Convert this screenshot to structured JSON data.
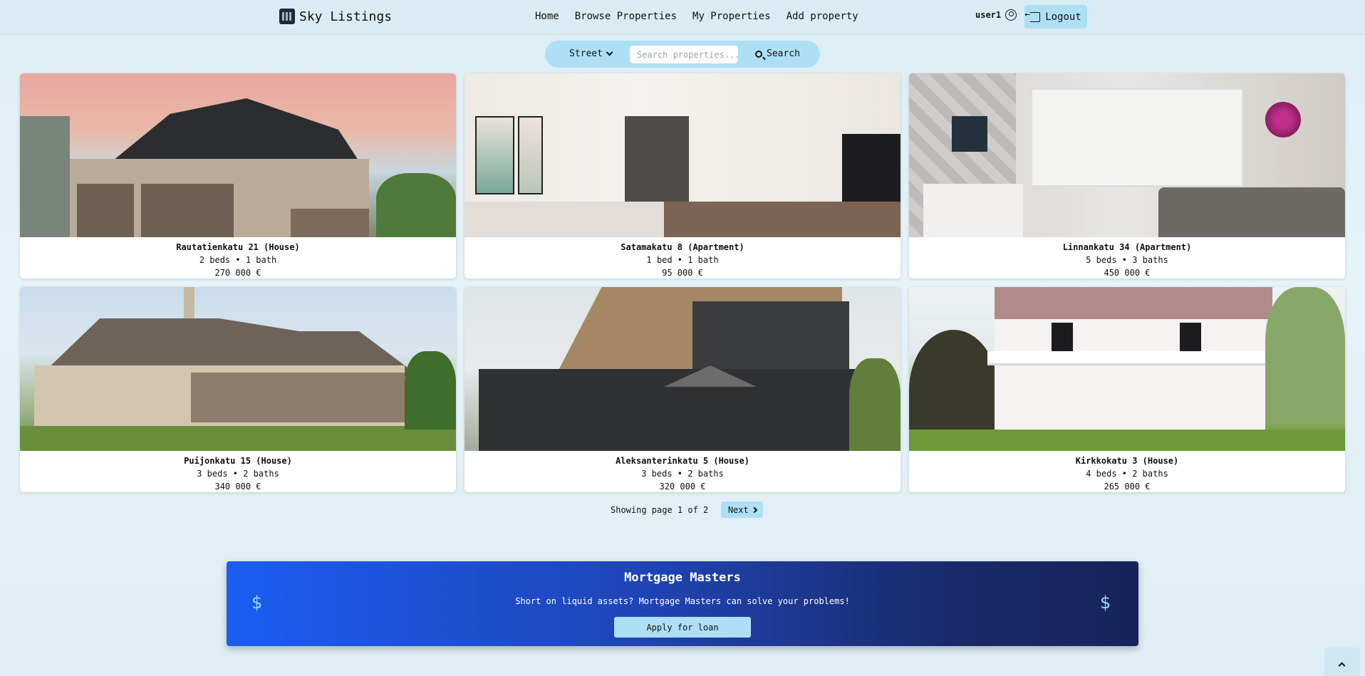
{
  "header": {
    "brand": "Sky Listings",
    "nav": [
      "Home",
      "Browse Properties",
      "My Properties",
      "Add property"
    ],
    "username": "user1",
    "logout_label": "Logout"
  },
  "search": {
    "field_selected": "Street",
    "placeholder": "Search properties...",
    "value": "",
    "button_label": "Search"
  },
  "listings": [
    {
      "title": "Rautatienkatu 21 (House)",
      "meta": "2 beds • 1 bath",
      "price": "270 000 €"
    },
    {
      "title": "Satamakatu 8 (Apartment)",
      "meta": "1 bed • 1 bath",
      "price": "95 000 €"
    },
    {
      "title": "Linnankatu 34 (Apartment)",
      "meta": "5 beds • 3 baths",
      "price": "450 000 €"
    },
    {
      "title": "Puijonkatu 15 (House)",
      "meta": "3 beds • 2 baths",
      "price": "340 000 €"
    },
    {
      "title": "Aleksanterinkatu 5 (House)",
      "meta": "3 beds • 2 baths",
      "price": "320 000 €"
    },
    {
      "title": "Kirkkokatu 3 (House)",
      "meta": "4 beds • 2 baths",
      "price": "265 000 €"
    }
  ],
  "pagination": {
    "text": "Showing page 1 of 2",
    "next_label": "Next"
  },
  "ad": {
    "title": "Mortgage Masters",
    "text": "Short on liquid assets? Mortgage Masters can solve your problems!",
    "button_label": "Apply for loan",
    "symbol": "$"
  },
  "colors": {
    "accent": "#aee0f5",
    "banner_start": "#1a5ef2",
    "banner_end": "#16245a"
  }
}
